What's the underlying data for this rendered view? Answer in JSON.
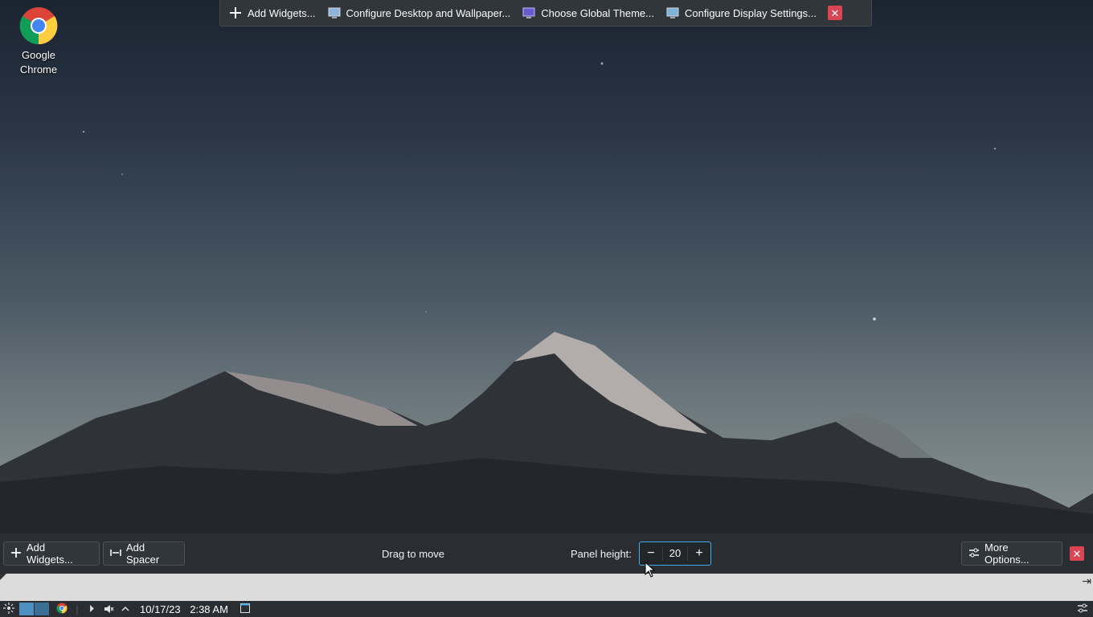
{
  "desktop": {
    "icons": [
      {
        "label": "Google Chrome",
        "icon": "chrome-icon"
      }
    ]
  },
  "top_toolbox": {
    "add_widgets": "Add Widgets...",
    "configure_desktop": "Configure Desktop and Wallpaper...",
    "choose_theme": "Choose Global Theme...",
    "configure_display": "Configure Display Settings..."
  },
  "panel_edit": {
    "add_widgets": "Add Widgets...",
    "add_spacer": "Add Spacer",
    "drag_to_move": "Drag to move",
    "panel_height_label": "Panel height:",
    "panel_height_value": "20",
    "more_options": "More Options..."
  },
  "taskbar": {
    "date": "10/17/23",
    "time": "2:38 AM"
  },
  "colors": {
    "close_red": "#da4453",
    "focus_blue": "#3daee9",
    "panel_bg": "#2a2e32"
  }
}
